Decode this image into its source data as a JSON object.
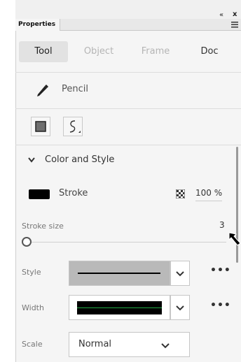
{
  "window": {
    "collapse_glyph": "«",
    "close_glyph": "x",
    "menu_icon": "hamburger-icon"
  },
  "panel_tab": "Properties",
  "segments": [
    {
      "label": "Tool",
      "active": true
    },
    {
      "label": "Object",
      "active": false
    },
    {
      "label": "Frame",
      "active": false
    },
    {
      "label": "Doc",
      "active": false
    }
  ],
  "tool": {
    "name": "Pencil",
    "icon": "pencil-icon"
  },
  "tool_options": {
    "object_drawing_icon": "object-drawing-icon",
    "pencil_mode_icon": "pencil-mode-smooth-icon"
  },
  "section": {
    "title": "Color and Style",
    "expanded": true
  },
  "stroke": {
    "label": "Stroke",
    "color": "#000000",
    "alpha": "100 %"
  },
  "stroke_size": {
    "label": "Stroke size",
    "value": "3"
  },
  "style": {
    "label": "Style",
    "more": "•••"
  },
  "width": {
    "label": "Width",
    "more": "•••"
  },
  "scale": {
    "label": "Scale",
    "value": "Normal"
  },
  "colors": {
    "accent_green": "#22aa44",
    "dropdown_gray": "#b9b9b9"
  }
}
